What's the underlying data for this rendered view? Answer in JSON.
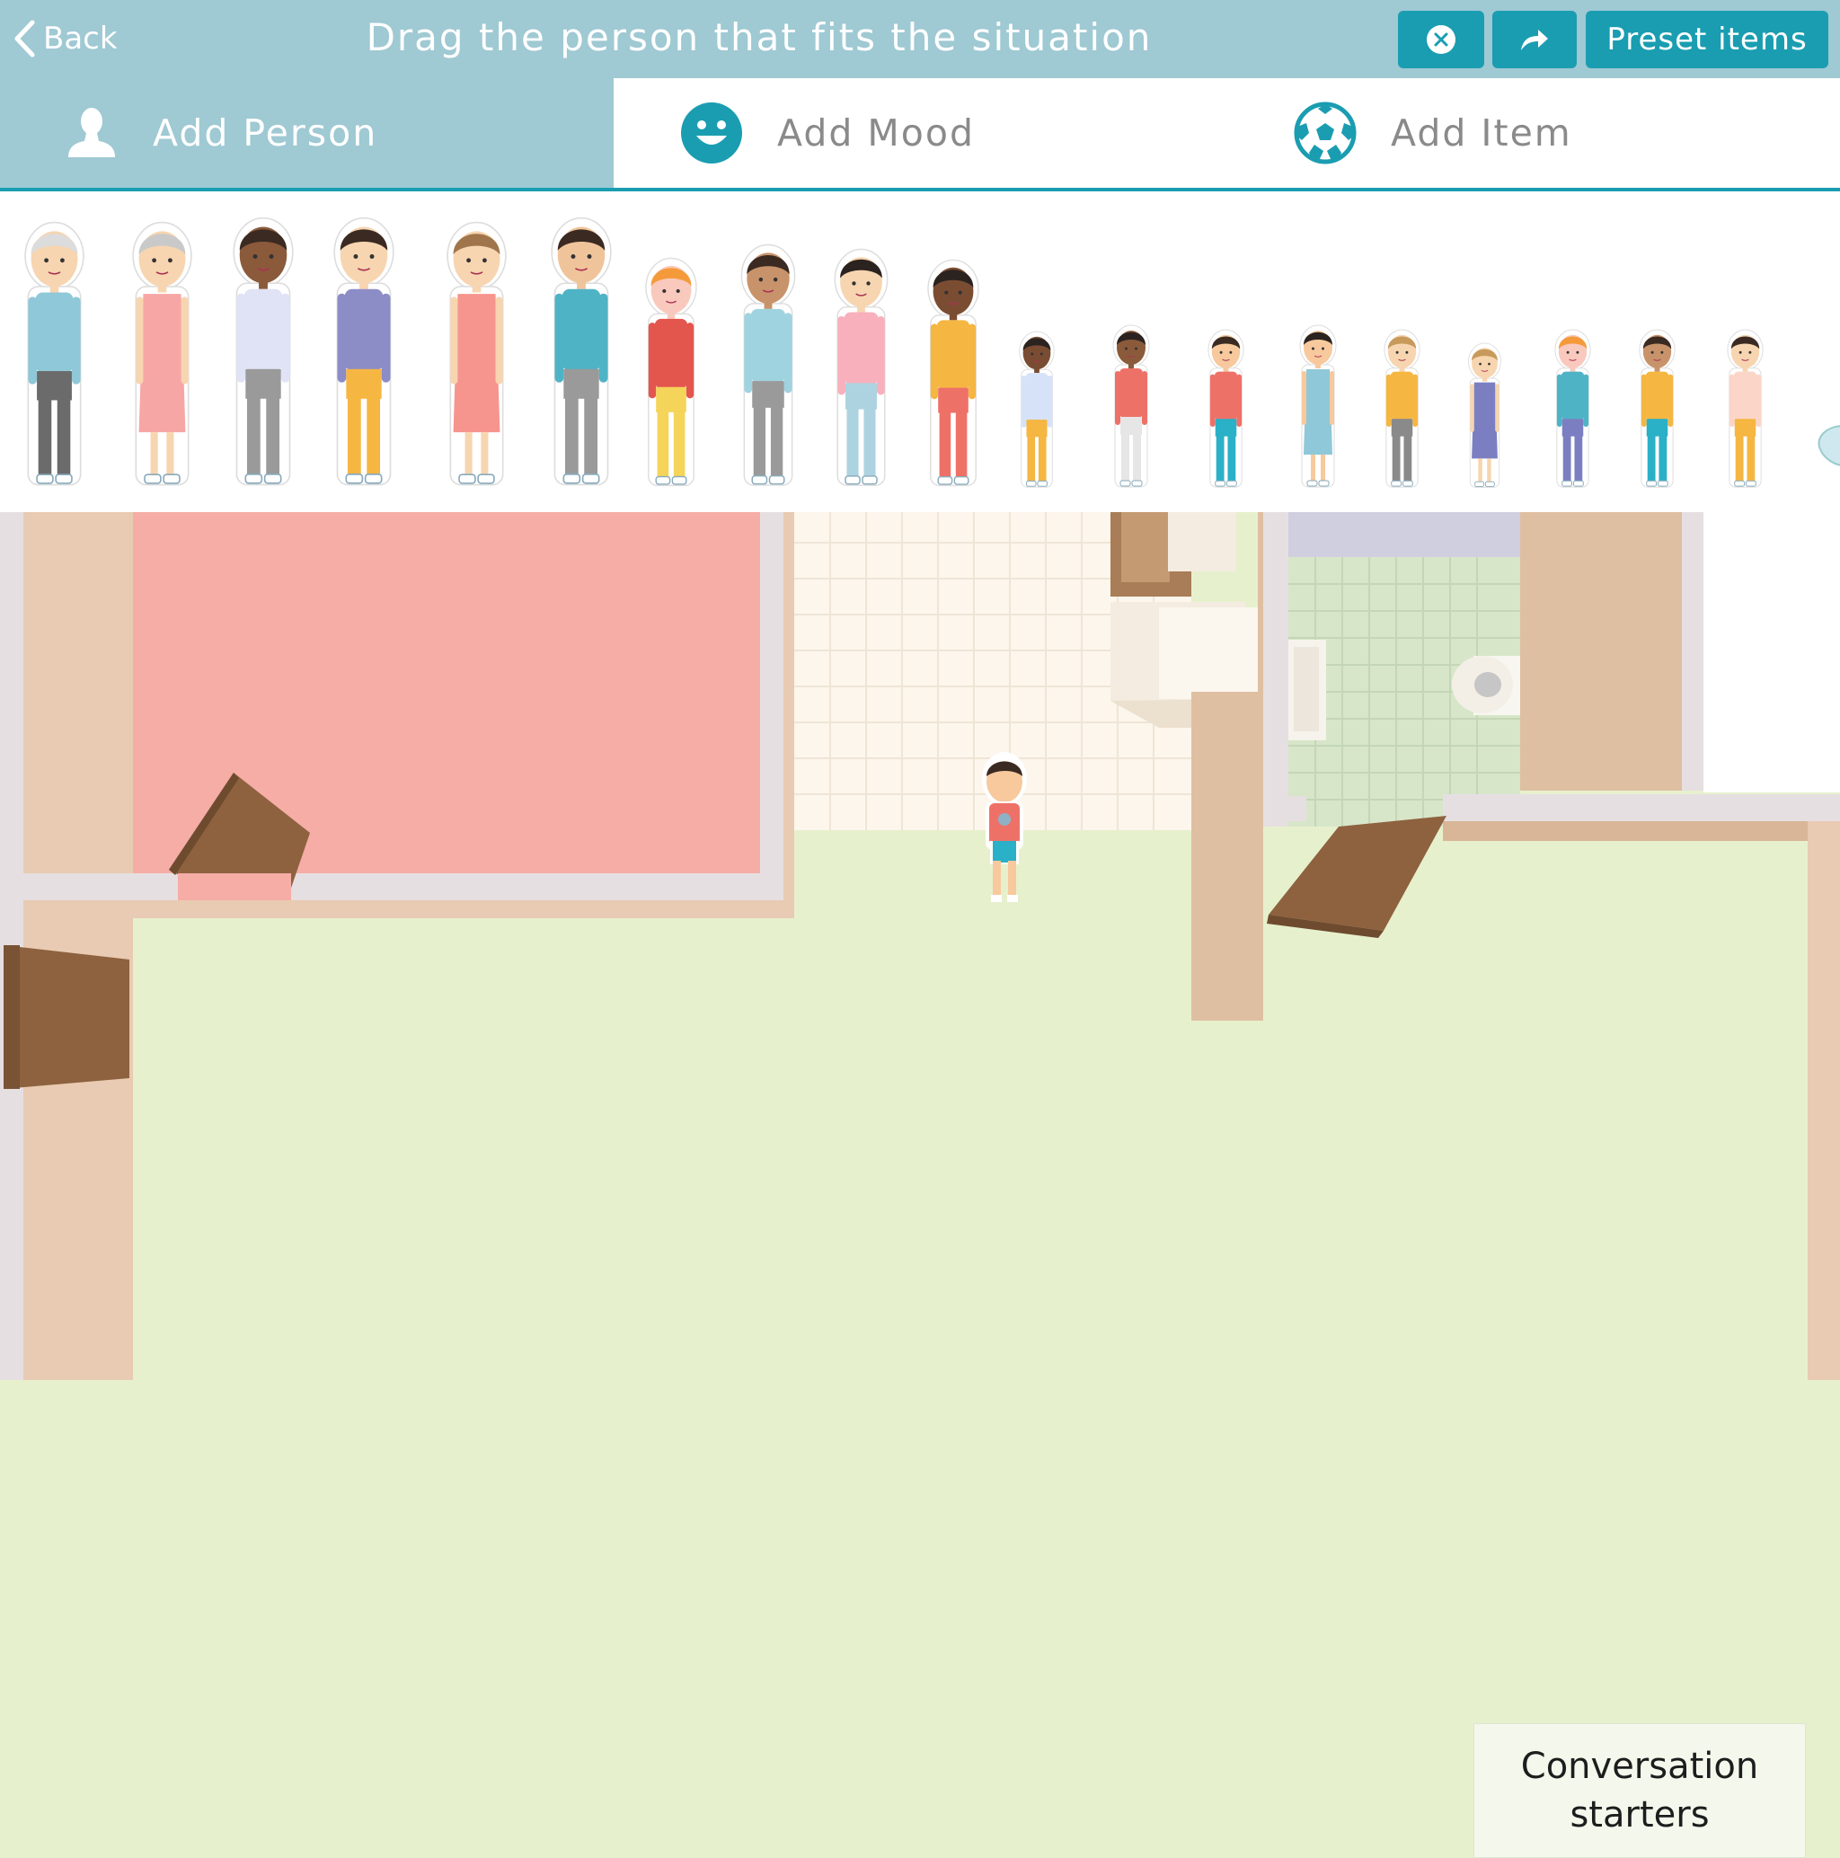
{
  "header": {
    "back_label": "Back",
    "title": "Drag the person that fits the situation",
    "close_icon": "close-circle-icon",
    "share_icon": "share-arrow-icon",
    "preset_label": "Preset items"
  },
  "tabs": [
    {
      "label": "Add Person",
      "icon": "person-icon",
      "active": true
    },
    {
      "label": "Add Mood",
      "icon": "smiley-icon",
      "active": false
    },
    {
      "label": "Add Item",
      "icon": "soccer-ball-icon",
      "active": false
    }
  ],
  "colors": {
    "header_bg": "#9fc9d3",
    "accent": "#1a9db1",
    "floor": "#e7f0cd",
    "bedroom_rug": "#f5ada6"
  },
  "room": {
    "conversation_line1": "Conversation",
    "conversation_line2": "starters"
  }
}
